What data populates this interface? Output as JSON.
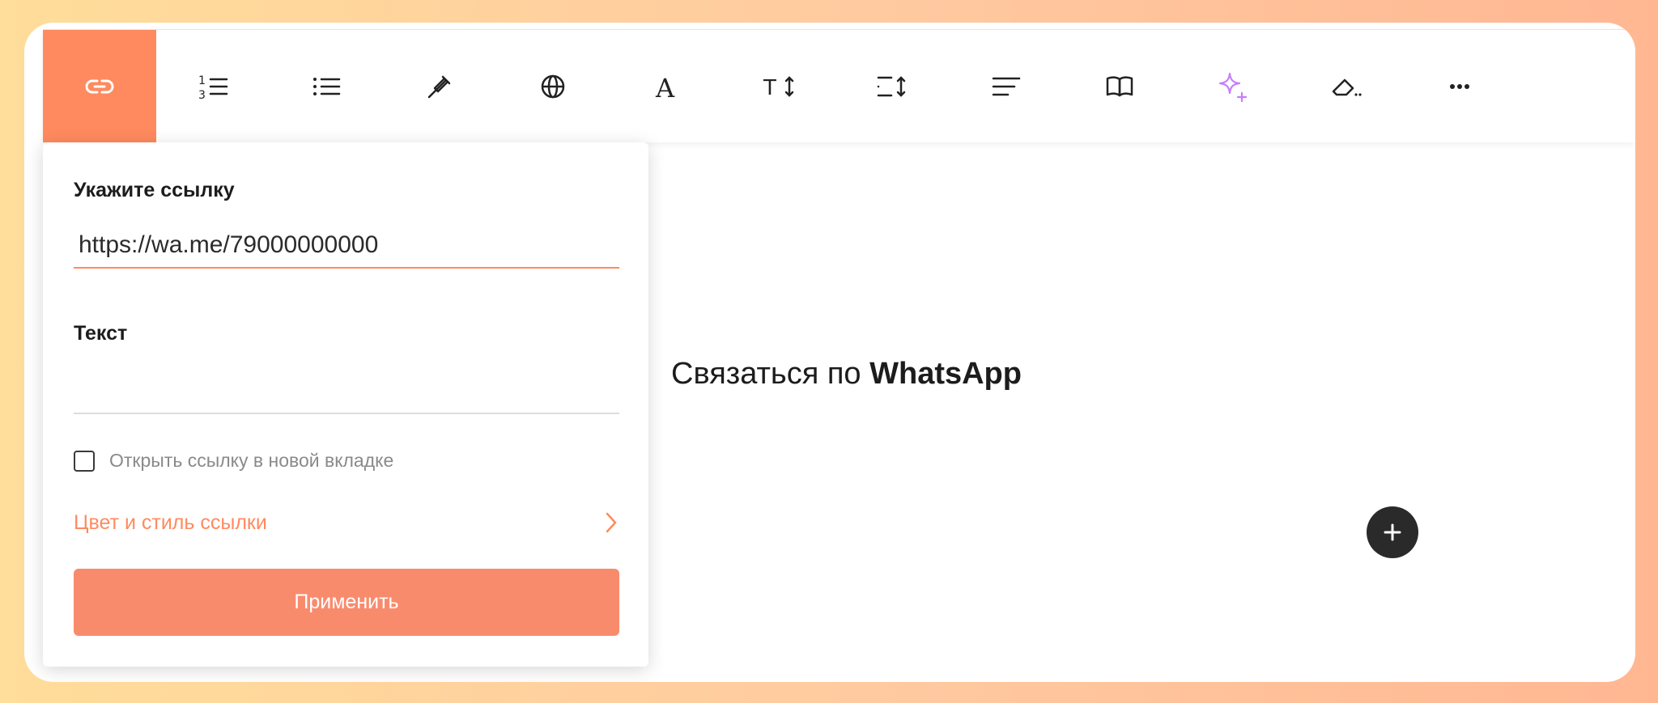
{
  "toolbar": {
    "items": [
      {
        "icon": "link-icon",
        "active": true
      },
      {
        "icon": "numbered-list-icon"
      },
      {
        "icon": "bullet-list-icon"
      },
      {
        "icon": "color-picker-icon"
      },
      {
        "icon": "globe-icon"
      },
      {
        "icon": "font-icon"
      },
      {
        "icon": "font-size-icon"
      },
      {
        "icon": "line-height-icon"
      },
      {
        "icon": "align-left-icon"
      },
      {
        "icon": "book-icon"
      },
      {
        "icon": "ai-sparkle-icon"
      },
      {
        "icon": "clear-format-icon"
      },
      {
        "icon": "more-icon"
      }
    ]
  },
  "link_popup": {
    "url_label": "Укажите ссылку",
    "url_value": "https://wa.me/79000000000",
    "text_label": "Текст",
    "text_value": "",
    "new_tab_label": "Открыть ссылку в новой вкладке",
    "new_tab_checked": false,
    "style_label": "Цвет и стиль ссылки",
    "apply_label": "Применить"
  },
  "content": {
    "text_regular": "Связаться по ",
    "text_bold": "WhatsApp"
  },
  "colors": {
    "accent": "#ff8a5f",
    "button": "#f98b6d",
    "ai_icon": "#c77dff",
    "add_button": "#2a2a2a"
  }
}
